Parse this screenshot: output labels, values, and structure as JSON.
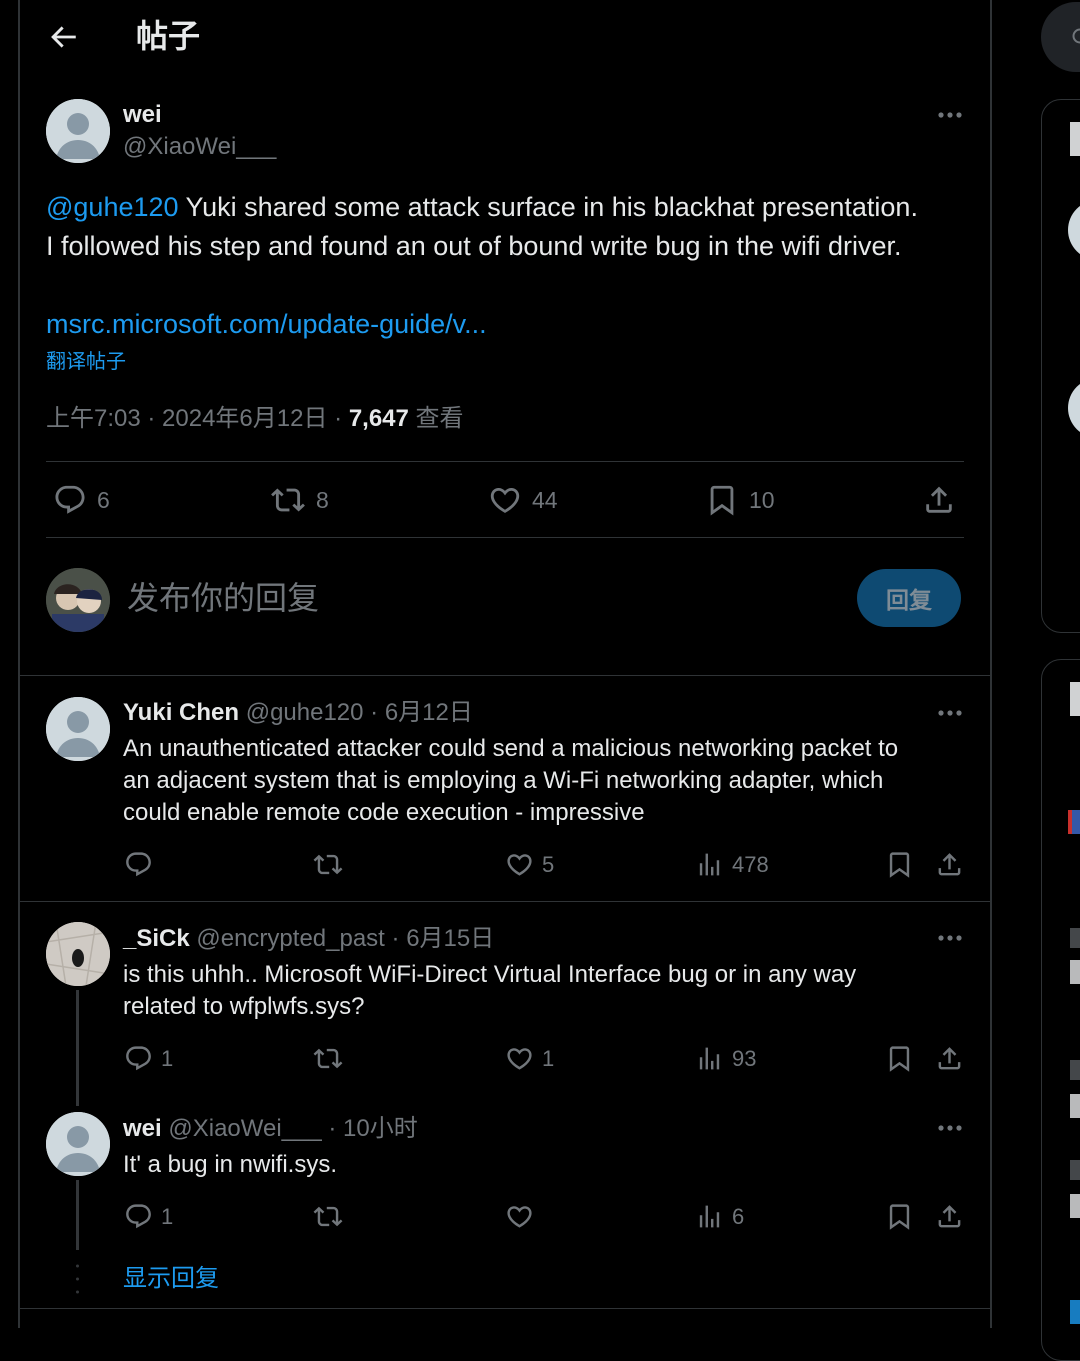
{
  "header": {
    "title": "帖子"
  },
  "post": {
    "author_name": "wei",
    "author_handle": "@XiaoWei___",
    "mention": "@guhe120",
    "text_line1_rest": " Yuki shared some attack surface in his blackhat presentation.",
    "text_line2": "I followed his step and found an out of bound write bug in the wifi driver.",
    "link": "msrc.microsoft.com/update-guide/v...",
    "translate_label": "翻译帖子",
    "time": "上午7:03 · 2024年6月12日 · ",
    "views_count": "7,647",
    "views_label": " 查看",
    "stats": {
      "replies": "6",
      "reposts": "8",
      "likes": "44",
      "bookmarks": "10"
    }
  },
  "composer": {
    "placeholder": "发布你的回复",
    "reply_button": "回复"
  },
  "replies": [
    {
      "name": "Yuki Chen",
      "handle": "@guhe120",
      "date": " · 6月12日",
      "lines": [
        "An unauthenticated attacker could send a malicious networking packet to",
        "an adjacent system that is employing a Wi-Fi networking adapter, which",
        "could enable remote code execution - impressive"
      ],
      "stats": {
        "replies": "",
        "reposts": "",
        "likes": "5",
        "views": "478"
      }
    },
    {
      "name": "_SiCk",
      "handle": "@encrypted_past",
      "date": " · 6月15日",
      "lines": [
        "is this uhhh.. Microsoft WiFi-Direct Virtual Interface bug or in any way",
        "related to wfplwfs.sys?"
      ],
      "stats": {
        "replies": "1",
        "reposts": "",
        "likes": "1",
        "views": "93"
      }
    },
    {
      "name": "wei",
      "handle": "@XiaoWei___",
      "date": " · 10小时",
      "lines": [
        "It' a bug in nwifi.sys."
      ],
      "stats": {
        "replies": "1",
        "reposts": "",
        "likes": "",
        "views": "6"
      }
    }
  ],
  "show_replies": "显示回复",
  "colors": {
    "accent": "#1d9bf0",
    "text": "#e7e9ea",
    "muted": "#71767b",
    "border": "#2f3336",
    "reply_button_bg": "#0e4a72"
  }
}
